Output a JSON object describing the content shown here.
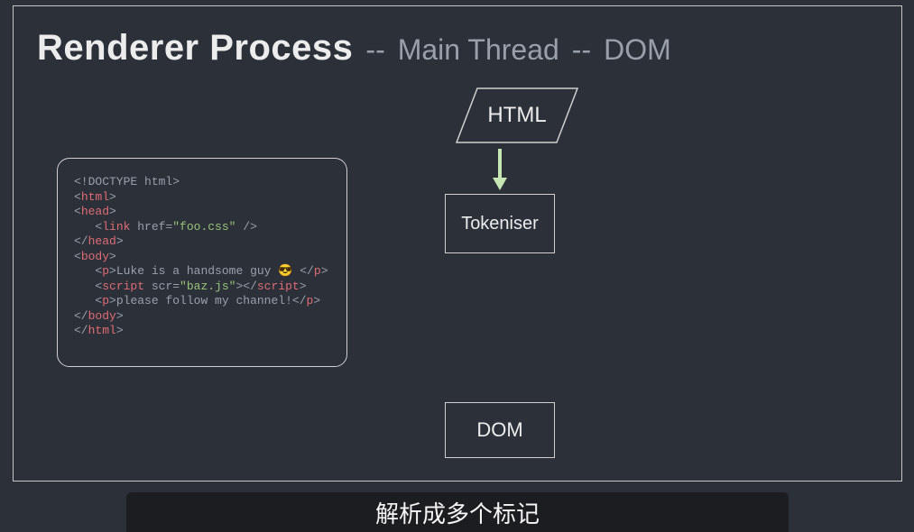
{
  "heading": {
    "main": "Renderer Process",
    "sep": "--",
    "sub1": "Main Thread",
    "sub2": "DOM"
  },
  "boxes": {
    "html": "HTML",
    "tokeniser": "Tokeniser",
    "dom": "DOM"
  },
  "code": {
    "tokens": [
      [
        [
          "pun",
          "<!DOCTYPE html>"
        ]
      ],
      [
        [
          "pun",
          "<"
        ],
        [
          "tag",
          "html"
        ],
        [
          "pun",
          ">"
        ]
      ],
      [
        [
          "pun",
          "<"
        ],
        [
          "tag",
          "head"
        ],
        [
          "pun",
          ">"
        ]
      ],
      [
        [
          "pun",
          "   <"
        ],
        [
          "tag",
          "link"
        ],
        [
          "attr",
          " href="
        ],
        [
          "str",
          "\"foo.css\""
        ],
        [
          "pun",
          " />"
        ]
      ],
      [
        [
          "pun",
          "</"
        ],
        [
          "tag",
          "head"
        ],
        [
          "pun",
          ">"
        ]
      ],
      [
        [
          "pun",
          "<"
        ],
        [
          "tag",
          "body"
        ],
        [
          "pun",
          ">"
        ]
      ],
      [
        [
          "pun",
          "   <"
        ],
        [
          "tag",
          "p"
        ],
        [
          "pun",
          ">"
        ],
        [
          "txt",
          "Luke is a handsome guy 😎 "
        ],
        [
          "pun",
          "</"
        ],
        [
          "tag",
          "p"
        ],
        [
          "pun",
          ">"
        ]
      ],
      [
        [
          "pun",
          "   <"
        ],
        [
          "tag",
          "script"
        ],
        [
          "attr",
          " scr="
        ],
        [
          "str",
          "\"baz.js\""
        ],
        [
          "pun",
          "></"
        ],
        [
          "tag",
          "script"
        ],
        [
          "pun",
          ">"
        ]
      ],
      [
        [
          "pun",
          "   <"
        ],
        [
          "tag",
          "p"
        ],
        [
          "pun",
          ">"
        ],
        [
          "txt",
          "please follow my channel!"
        ],
        [
          "pun",
          "</"
        ],
        [
          "tag",
          "p"
        ],
        [
          "pun",
          ">"
        ]
      ],
      [
        [
          "pun",
          "</"
        ],
        [
          "tag",
          "body"
        ],
        [
          "pun",
          ">"
        ]
      ],
      [
        [
          "pun",
          "</"
        ],
        [
          "tag",
          "html"
        ],
        [
          "pun",
          ">"
        ]
      ]
    ]
  },
  "caption": "解析成多个标记",
  "colors": {
    "bg": "#2b3039",
    "border": "#d0d0d0",
    "text": "#ececec",
    "muted": "#9aa0aa",
    "tag": "#e06c75",
    "string": "#98c379",
    "arrow": "#c6e7b3"
  }
}
